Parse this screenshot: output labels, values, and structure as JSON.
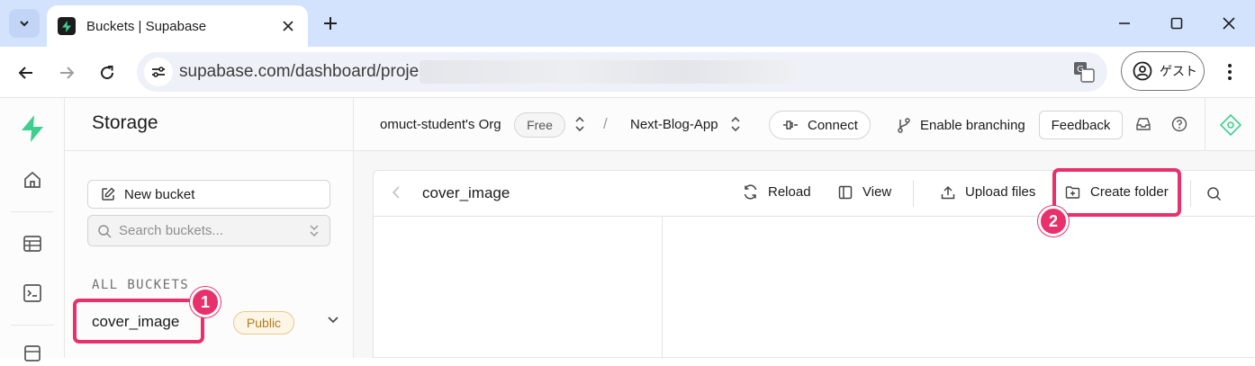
{
  "browser": {
    "tab_title": "Buckets | Supabase",
    "url": "supabase.com/dashboard/project/",
    "profile_label": "ゲスト"
  },
  "sidebar": {
    "title": "Storage",
    "new_bucket_label": "New bucket",
    "search_placeholder": "Search buckets...",
    "section_label": "ALL BUCKETS",
    "buckets": [
      {
        "name": "cover_image",
        "badge": "Public"
      }
    ]
  },
  "topbar": {
    "org": "omuct-student's Org",
    "plan": "Free",
    "separator": "/",
    "project": "Next-Blog-App",
    "connect_label": "Connect",
    "branching_label": "Enable branching",
    "feedback_label": "Feedback"
  },
  "explorer": {
    "path": "cover_image",
    "reload_label": "Reload",
    "view_label": "View",
    "upload_label": "Upload files",
    "create_folder_label": "Create folder"
  },
  "annotations": {
    "step1": "1",
    "step2": "2",
    "highlight_color": "#e8306a"
  },
  "colors": {
    "brand": "#3ecf8e",
    "badge_text": "#b57a1a"
  }
}
